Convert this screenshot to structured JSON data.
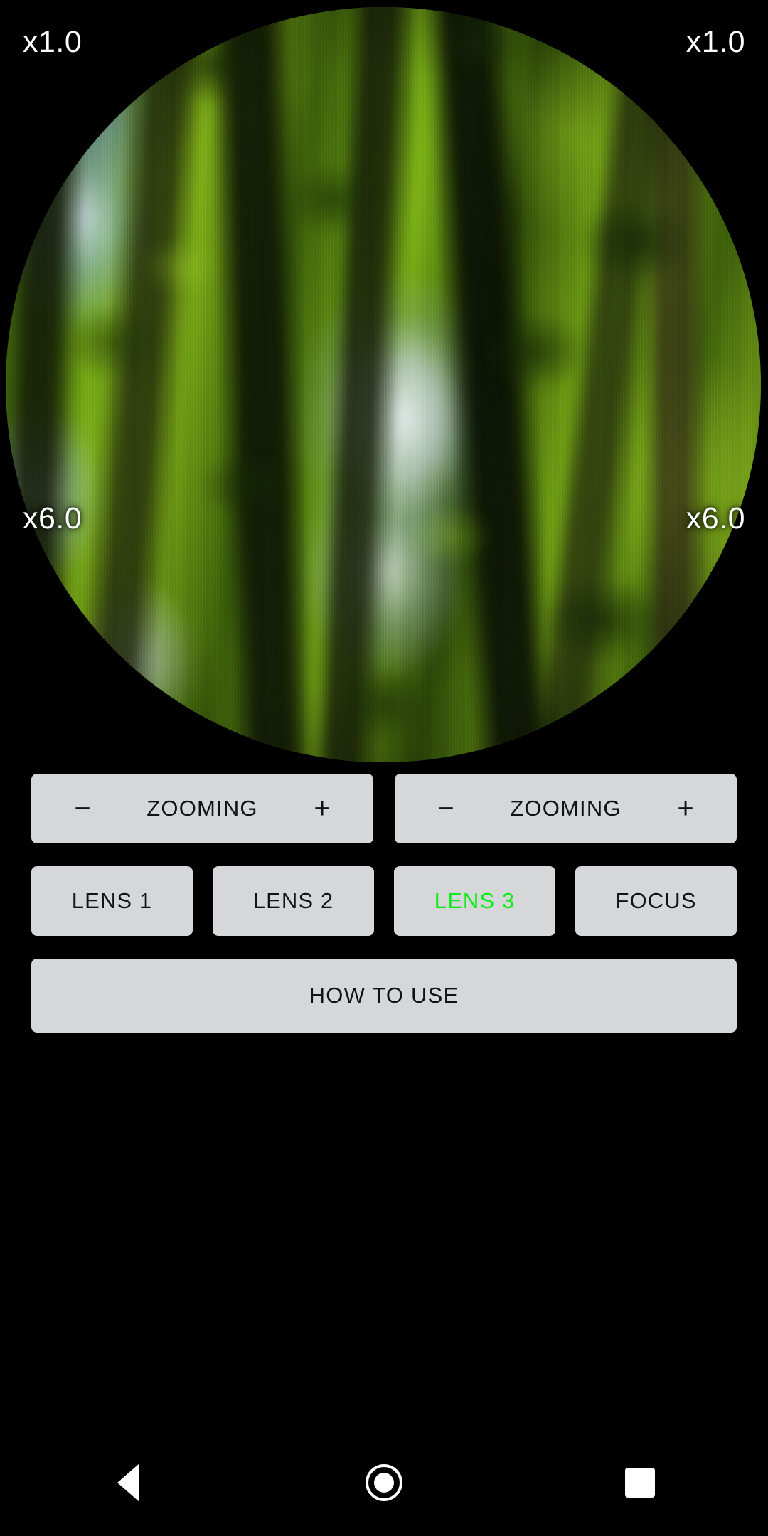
{
  "app": {
    "background_color": "#000000",
    "accent_color": "#0ceb17",
    "button_color": "#d6d7d9"
  },
  "viewport": {
    "name": "magnifier-camera-preview",
    "shape": "circle",
    "scene_description": "blurred forest canopy with vertical tree trunks, bright green foliage and blue-white sky gaps"
  },
  "zoom_labels": {
    "top_left": "x1.0",
    "top_right": "x1.0",
    "bottom_left": "x6.0",
    "bottom_right": "x6.0"
  },
  "controls": {
    "zoom_row": [
      {
        "minus": "−",
        "label": "ZOOMING",
        "plus": "+"
      },
      {
        "minus": "−",
        "label": "ZOOMING",
        "plus": "+"
      }
    ],
    "lens_row": [
      {
        "label": "LENS 1",
        "active": false
      },
      {
        "label": "LENS 2",
        "active": false
      },
      {
        "label": "LENS 3",
        "active": true
      },
      {
        "label": "FOCUS",
        "active": false
      }
    ],
    "help_button": "HOW TO USE"
  },
  "navbar": {
    "back": "back-icon",
    "home": "home-icon",
    "recents": "recents-icon"
  }
}
